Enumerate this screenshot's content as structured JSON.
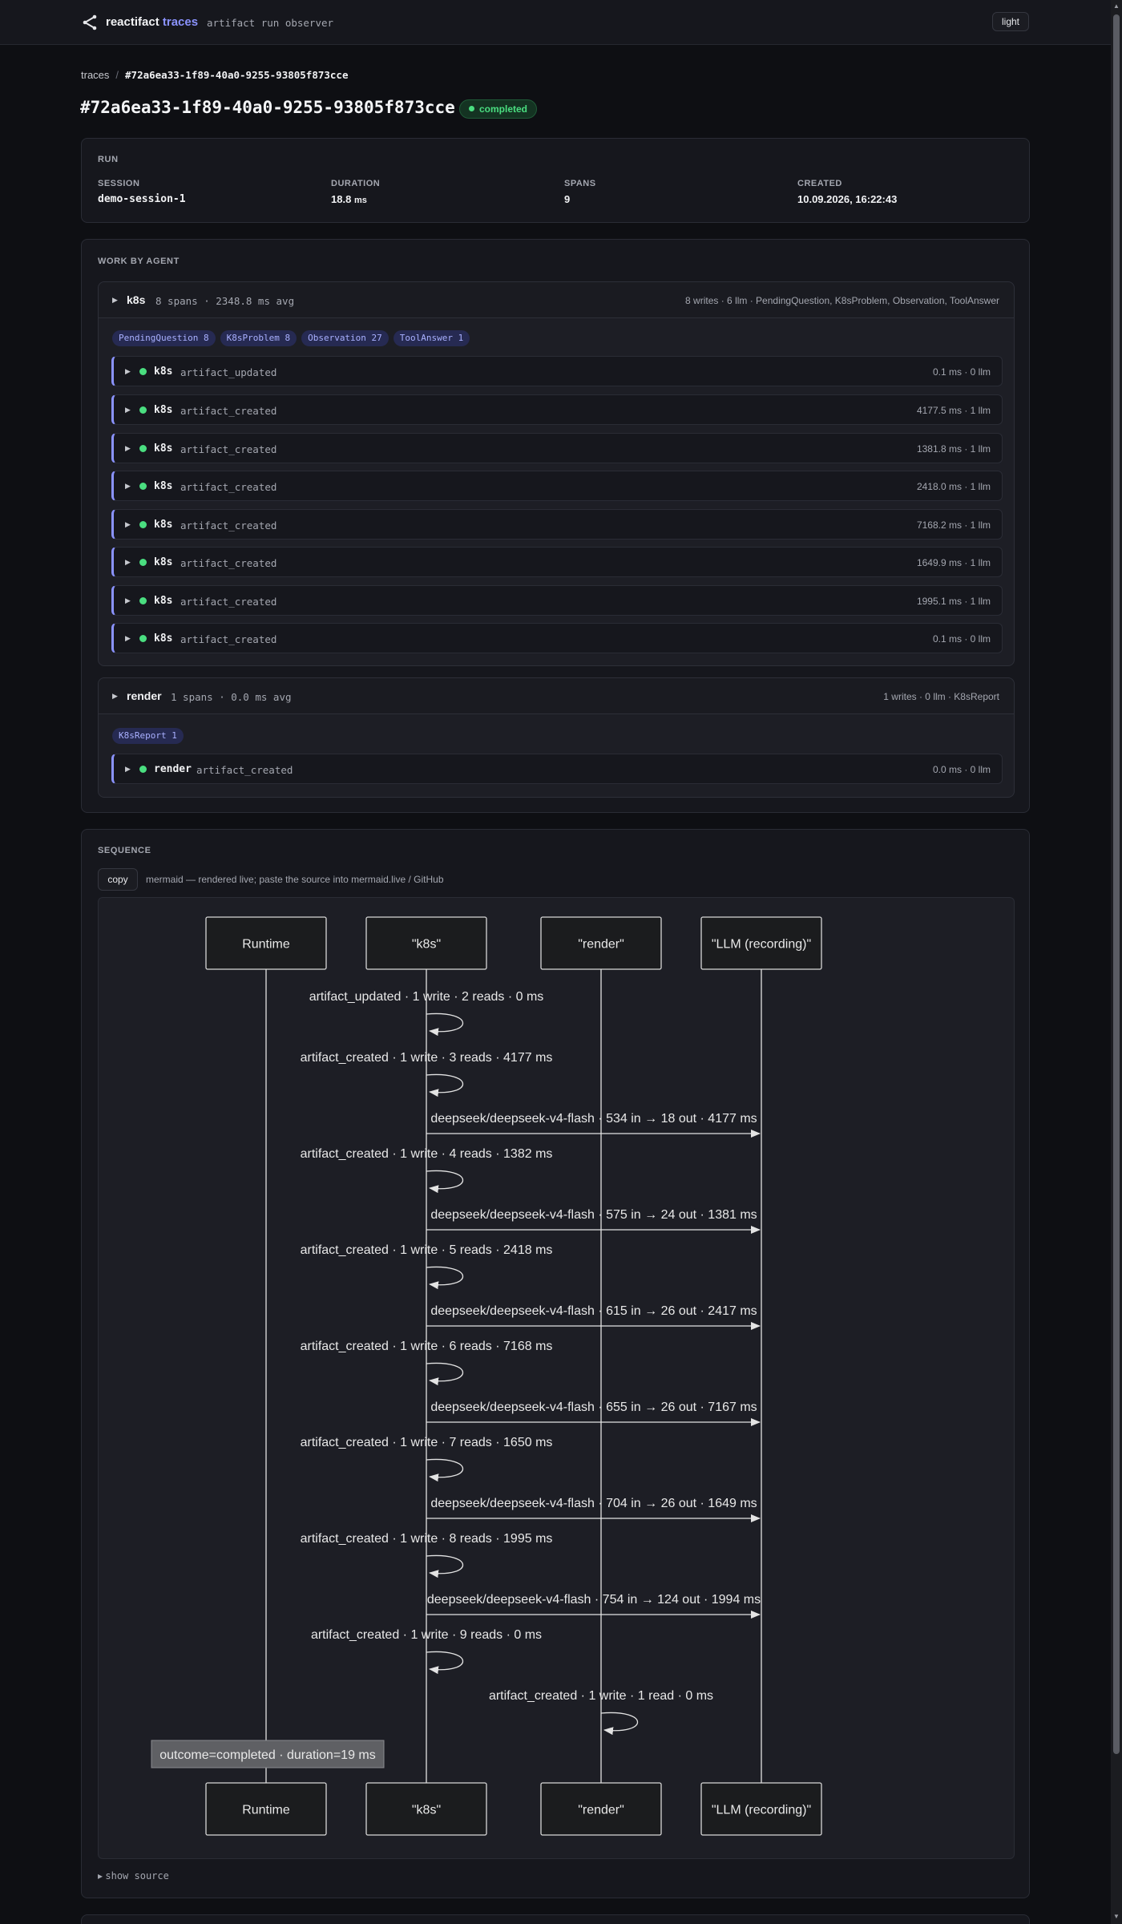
{
  "header": {
    "brand_name": "reactifact",
    "brand_accent": "traces",
    "subtitle": "artifact run observer",
    "theme_toggle": "light",
    "logo_icon": "share-nodes-icon"
  },
  "breadcrumb": {
    "root": "traces",
    "separator": "/",
    "current": "#72a6ea33-1f89-40a0-9255-93805f873cce"
  },
  "title": "#72a6ea33-1f89-40a0-9255-93805f873cce",
  "status": "completed",
  "run": {
    "label": "RUN",
    "fields": [
      {
        "key": "SESSION",
        "value": "demo-session-1"
      },
      {
        "key": "DURATION",
        "value": "18.8",
        "unit": "ms"
      },
      {
        "key": "SPANS",
        "value": "9"
      },
      {
        "key": "CREATED",
        "value": "10.09.2026, 16:22:43"
      }
    ]
  },
  "work": {
    "label": "WORK BY AGENT",
    "agents": [
      {
        "name": "k8s",
        "stats": "8 spans · 2348.8 ms avg",
        "summary": "8 writes · 6 llm · PendingQuestion, K8sProblem, Observation, ToolAnswer",
        "tags": [
          "PendingQuestion 8",
          "K8sProblem 8",
          "Observation 27",
          "ToolAnswer 1"
        ],
        "spans": [
          {
            "name": "k8s",
            "kind": "artifact_updated",
            "meta": "0.1 ms · 0 llm"
          },
          {
            "name": "k8s",
            "kind": "artifact_created",
            "meta": "4177.5 ms · 1 llm"
          },
          {
            "name": "k8s",
            "kind": "artifact_created",
            "meta": "1381.8 ms · 1 llm"
          },
          {
            "name": "k8s",
            "kind": "artifact_created",
            "meta": "2418.0 ms · 1 llm"
          },
          {
            "name": "k8s",
            "kind": "artifact_created",
            "meta": "7168.2 ms · 1 llm"
          },
          {
            "name": "k8s",
            "kind": "artifact_created",
            "meta": "1649.9 ms · 1 llm"
          },
          {
            "name": "k8s",
            "kind": "artifact_created",
            "meta": "1995.1 ms · 1 llm"
          },
          {
            "name": "k8s",
            "kind": "artifact_created",
            "meta": "0.1 ms · 0 llm"
          }
        ]
      },
      {
        "name": "render",
        "stats": "1 spans · 0.0 ms avg",
        "summary": "1 writes · 0 llm · K8sReport",
        "tags": [
          "K8sReport 1"
        ],
        "spans": [
          {
            "name": "render",
            "kind": "artifact_created",
            "meta": "0.0 ms · 0 llm"
          }
        ]
      }
    ]
  },
  "sequence": {
    "label": "SEQUENCE",
    "copy_label": "copy",
    "hint": "mermaid — rendered live; paste the source into mermaid.live / GitHub",
    "show_source": "show source",
    "participants": [
      "Runtime",
      "\"k8s\"",
      "\"render\"",
      "\"LLM (recording)\""
    ],
    "messages": [
      {
        "type": "self",
        "from": 1,
        "text": "artifact_updated · 1 write · 2 reads · 0 ms"
      },
      {
        "type": "self",
        "from": 1,
        "text": "artifact_created · 1 write · 3 reads · 4177 ms"
      },
      {
        "type": "call",
        "from": 1,
        "to": 3,
        "text": "deepseek/deepseek-v4-flash · 534 in → 18 out · 4177 ms"
      },
      {
        "type": "self",
        "from": 1,
        "text": "artifact_created · 1 write · 4 reads · 1382 ms"
      },
      {
        "type": "call",
        "from": 1,
        "to": 3,
        "text": "deepseek/deepseek-v4-flash · 575 in → 24 out · 1381 ms"
      },
      {
        "type": "self",
        "from": 1,
        "text": "artifact_created · 1 write · 5 reads · 2418 ms"
      },
      {
        "type": "call",
        "from": 1,
        "to": 3,
        "text": "deepseek/deepseek-v4-flash · 615 in → 26 out · 2417 ms"
      },
      {
        "type": "self",
        "from": 1,
        "text": "artifact_created · 1 write · 6 reads · 7168 ms"
      },
      {
        "type": "call",
        "from": 1,
        "to": 3,
        "text": "deepseek/deepseek-v4-flash · 655 in → 26 out · 7167 ms"
      },
      {
        "type": "self",
        "from": 1,
        "text": "artifact_created · 1 write · 7 reads · 1650 ms"
      },
      {
        "type": "call",
        "from": 1,
        "to": 3,
        "text": "deepseek/deepseek-v4-flash · 704 in → 26 out · 1649 ms"
      },
      {
        "type": "self",
        "from": 1,
        "text": "artifact_created · 1 write · 8 reads · 1995 ms"
      },
      {
        "type": "call",
        "from": 1,
        "to": 3,
        "text": "deepseek/deepseek-v4-flash · 754 in → 124 out · 1994 ms"
      },
      {
        "type": "self",
        "from": 1,
        "text": "artifact_created · 1 write · 9 reads · 0 ms"
      },
      {
        "type": "self",
        "from": 2,
        "text": "artifact_created · 1 write · 1 read · 0 ms"
      }
    ],
    "note": "outcome=completed · duration=19 ms"
  }
}
